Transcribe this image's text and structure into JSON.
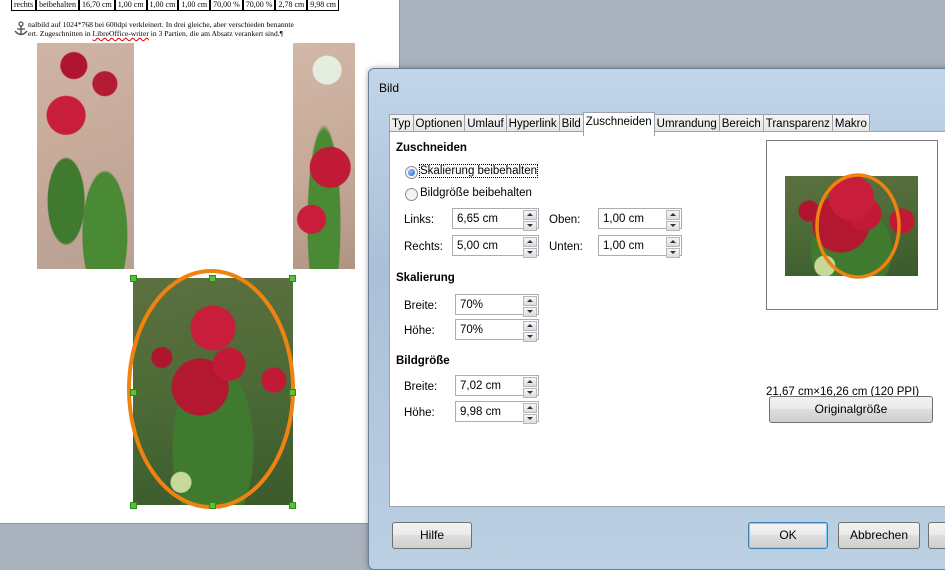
{
  "document": {
    "table_cells": [
      "rechts",
      "beibehalten",
      "16,70 cm",
      "1,00 cm",
      "1,00 cm",
      "1,00 cm",
      "70,00 %",
      "70,00 %",
      "2,78 cm",
      "9,98 cm"
    ],
    "caption_line1_a": "nalbild auf 1024*768 bei 600dpi verkleinert. In drei gleiche, aber verschieden benannte",
    "caption_line2_a": "ert. Zugeschnitten in ",
    "caption_line2_u": "LibreOffice-writer",
    "caption_line2_b": " in 3 Partien, die am Absatz verankert sind.¶"
  },
  "dialog": {
    "title": "Bild",
    "tabs": [
      "Typ",
      "Optionen",
      "Umlauf",
      "Hyperlink",
      "Bild",
      "Zuschneiden",
      "Umrandung",
      "Bereich",
      "Transparenz",
      "Makro"
    ],
    "active_tab": "Zuschneiden",
    "crop": {
      "heading": "Zuschneiden",
      "radio_keep_scale": "Skalierung beibehalten",
      "radio_keep_size": "Bildgröße beibehalten",
      "selected": "Skalierung beibehalten",
      "left_label": "Links:",
      "left_value": "6,65 cm",
      "top_label": "Oben:",
      "top_value": "1,00 cm",
      "right_label": "Rechts:",
      "right_value": "5,00 cm",
      "bottom_label": "Unten:",
      "bottom_value": "1,00 cm"
    },
    "scale": {
      "heading": "Skalierung",
      "width_label": "Breite:",
      "width_value": "70%",
      "height_label": "Höhe:",
      "height_value": "70%"
    },
    "size": {
      "heading": "Bildgröße",
      "width_label": "Breite:",
      "width_value": "7,02 cm",
      "height_label": "Höhe:",
      "height_value": "9,98 cm"
    },
    "original_size_text": "21,67 cm×16,26 cm (120 PPI)",
    "original_size_button": "Originalgröße",
    "buttons": {
      "help": "Hilfe",
      "ok": "OK",
      "cancel": "Abbrechen"
    }
  },
  "colors": {
    "ellipse": "#f0820f",
    "handle": "#57c138",
    "accent": "#1f5ec8"
  }
}
